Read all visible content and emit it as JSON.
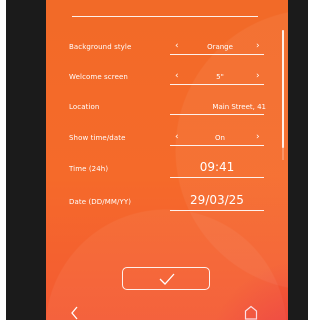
{
  "settings": {
    "rows": [
      {
        "label": "Background style",
        "value": "Orange"
      },
      {
        "label": "Welcome screen",
        "value": "5\""
      },
      {
        "label": "Location",
        "value": "Main Street, 41"
      },
      {
        "label": "Show time/date",
        "value": "On"
      },
      {
        "label": "Time (24h)",
        "value": "09:41"
      },
      {
        "label": "Date (DD/MM/YY)",
        "value": "29/03/25"
      }
    ],
    "chevron_left": "‹",
    "chevron_right": "›"
  },
  "icons": {
    "confirm": "checkmark-icon",
    "back": "back-arrow-icon",
    "home": "home-icon"
  },
  "colors": {
    "background_top": "#f26a28",
    "background_bottom": "#f45a33",
    "text": "#ffffff",
    "bezel": "#1b1b1b"
  }
}
